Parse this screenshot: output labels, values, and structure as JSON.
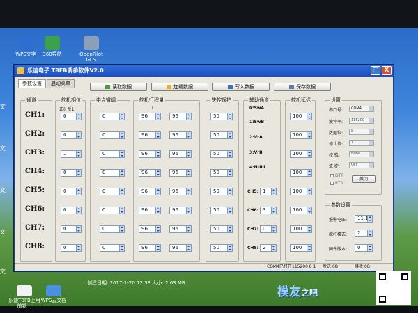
{
  "desktop": {
    "icons": [
      {
        "label": "WPS文字"
      },
      {
        "label": "360导航"
      },
      {
        "label": "OpenPilot GCS"
      }
    ],
    "bottom_icons": [
      {
        "label": "乐迪T8FB上用前锁..."
      },
      {
        "label": "WPS云文档"
      }
    ],
    "side_labels": [
      "文",
      "文",
      "文",
      "文",
      "文"
    ]
  },
  "window": {
    "title": "乐迪电子 T8FB调参软件V2.0",
    "min_label": "_",
    "max_label": "□",
    "close_label": "X",
    "tabs": [
      {
        "label": "参数设置"
      },
      {
        "label": "启动菜单"
      }
    ],
    "toolbar": [
      {
        "label": "读取数据",
        "icon": "read-icon"
      },
      {
        "label": "加载数据",
        "icon": "load-icon"
      },
      {
        "label": "写入数据",
        "icon": "write-icon"
      },
      {
        "label": "保存数据",
        "icon": "save-icon"
      }
    ]
  },
  "groups": {
    "channel": "通道",
    "reverse": "舵机相位",
    "reverse_sub": "正0  反1",
    "trim": "中点微调",
    "travel": "舵机行程量",
    "travel_sub": "L",
    "failsafe": "失控保护",
    "aux": "辅助通道",
    "delay": "舵机延迟",
    "settings": "设置",
    "params": "参数设置"
  },
  "channels": [
    {
      "name": "CH1:",
      "reverse": "0",
      "trim": "0",
      "travel_l": "96",
      "travel_r": "96",
      "failsafe": "50",
      "delay": "100"
    },
    {
      "name": "CH2:",
      "reverse": "0",
      "trim": "0",
      "travel_l": "96",
      "travel_r": "96",
      "failsafe": "50",
      "delay": "100"
    },
    {
      "name": "CH3:",
      "reverse": "1",
      "trim": "0",
      "travel_l": "96",
      "travel_r": "96",
      "failsafe": "50",
      "delay": "100"
    },
    {
      "name": "CH4:",
      "reverse": "0",
      "trim": "0",
      "travel_l": "96",
      "travel_r": "96",
      "failsafe": "50",
      "delay": "100"
    },
    {
      "name": "CH5:",
      "reverse": "0",
      "trim": "0",
      "travel_l": "96",
      "travel_r": "96",
      "failsafe": "50",
      "delay": "100"
    },
    {
      "name": "CH6:",
      "reverse": "0",
      "trim": "0",
      "travel_l": "96",
      "travel_r": "96",
      "failsafe": "50",
      "delay": "100"
    },
    {
      "name": "CH7:",
      "reverse": "0",
      "trim": "0",
      "travel_l": "96",
      "travel_r": "96",
      "failsafe": "50",
      "delay": "100"
    },
    {
      "name": "CH8:",
      "reverse": "0",
      "trim": "0",
      "travel_l": "96",
      "travel_r": "96",
      "failsafe": "50",
      "delay": "100"
    }
  ],
  "aux_labels": [
    "0:SwA",
    "1:SwB",
    "2:VrA",
    "3:VrB",
    "4:NULL"
  ],
  "aux_channels": [
    {
      "label": "CH5:",
      "value": "1"
    },
    {
      "label": "CH6:",
      "value": "3"
    },
    {
      "label": "CH7:",
      "value": "0"
    },
    {
      "label": "CH8:",
      "value": "2"
    }
  ],
  "settings": {
    "rows": [
      {
        "label": "串口号:",
        "value": "COM4"
      },
      {
        "label": "波特率:",
        "value": "115200"
      },
      {
        "label": "数据位:",
        "value": "8"
      },
      {
        "label": "停止位:",
        "value": "1"
      },
      {
        "label": "校  验:",
        "value": "None"
      },
      {
        "label": "流  控:",
        "value": "OFF"
      }
    ],
    "checks": [
      "DTR",
      "RTS"
    ],
    "close_label": "关闭"
  },
  "params": {
    "rows": [
      {
        "label": "报警电压:",
        "value": "11.1"
      },
      {
        "label": "舵杆模式:",
        "value": "2"
      },
      {
        "label": "固件版本:",
        "value": "0"
      }
    ]
  },
  "status": {
    "port": "COM4已打开",
    "baud": "115200 8 1",
    "sent": "发送:0B",
    "recv": "接收:0B"
  },
  "taskbar": {
    "info": "创建日期: 2017-1-20 12:58  大小: 2.63 MB"
  },
  "watermark": {
    "main": "模友",
    "sub": "之吧"
  },
  "colors": {
    "title_bar": "#1d4ec0",
    "window_bg": "#e9e6dd",
    "spin_arrow": "#c9daf5"
  }
}
